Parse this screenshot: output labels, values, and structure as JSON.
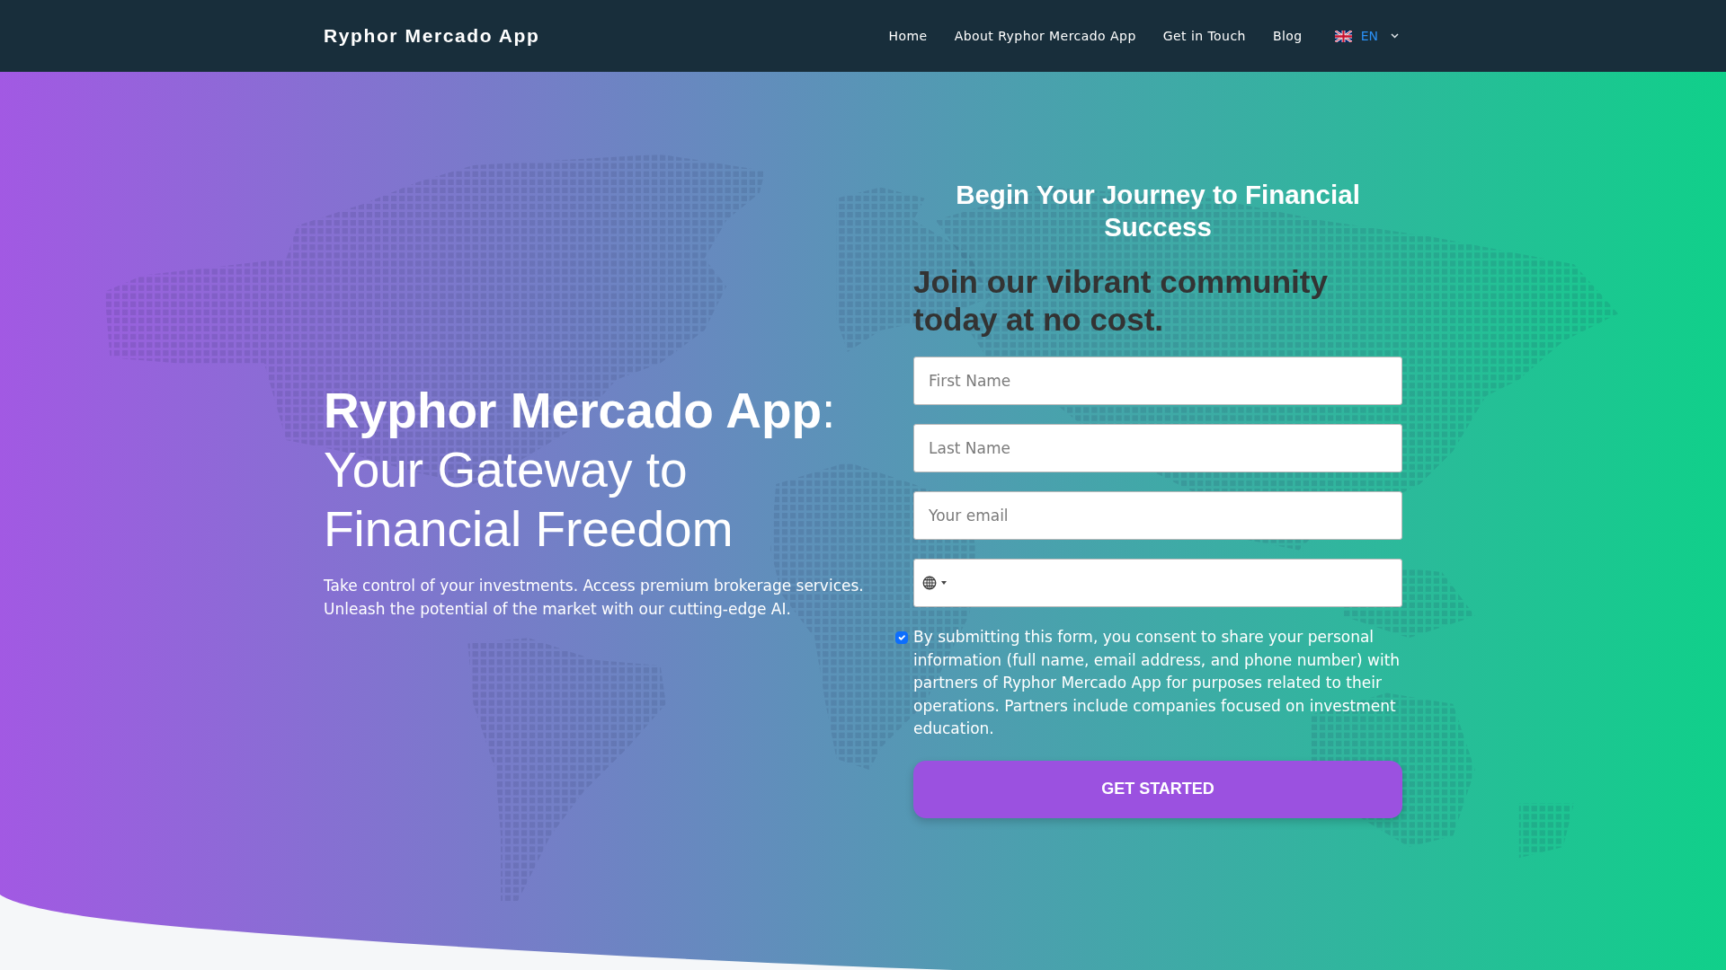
{
  "navbar": {
    "brand": "Ryphor Mercado App",
    "links": [
      {
        "label": "Home"
      },
      {
        "label": "About Ryphor Mercado App"
      },
      {
        "label": "Get in Touch"
      },
      {
        "label": "Blog"
      }
    ],
    "language": {
      "label": "EN"
    }
  },
  "hero": {
    "headline": "**Ryphor Mercado App**: Your Gateway to Financial Freedom",
    "description": "Take control of your investments. Access premium brokerage services. Unleash the potential of the market with our cutting-edge AI."
  },
  "form": {
    "title": "Begin Your Journey to Financial Success",
    "subtitle": "Join our vibrant community today at no cost.",
    "fields": [
      {
        "kind": "text",
        "placeholder": "First Name"
      },
      {
        "kind": "text",
        "placeholder": "Last Name"
      },
      {
        "kind": "email",
        "placeholder": "Your email"
      },
      {
        "kind": "phone"
      }
    ],
    "consent": {
      "checked": true,
      "text": "By submitting this form, you consent to share your personal information (full name, email address, and phone number) with partners of Ryphor Mercado App for purposes related to their operations. Partners include companies focused on investment education."
    },
    "submit": "GET STARTED"
  }
}
